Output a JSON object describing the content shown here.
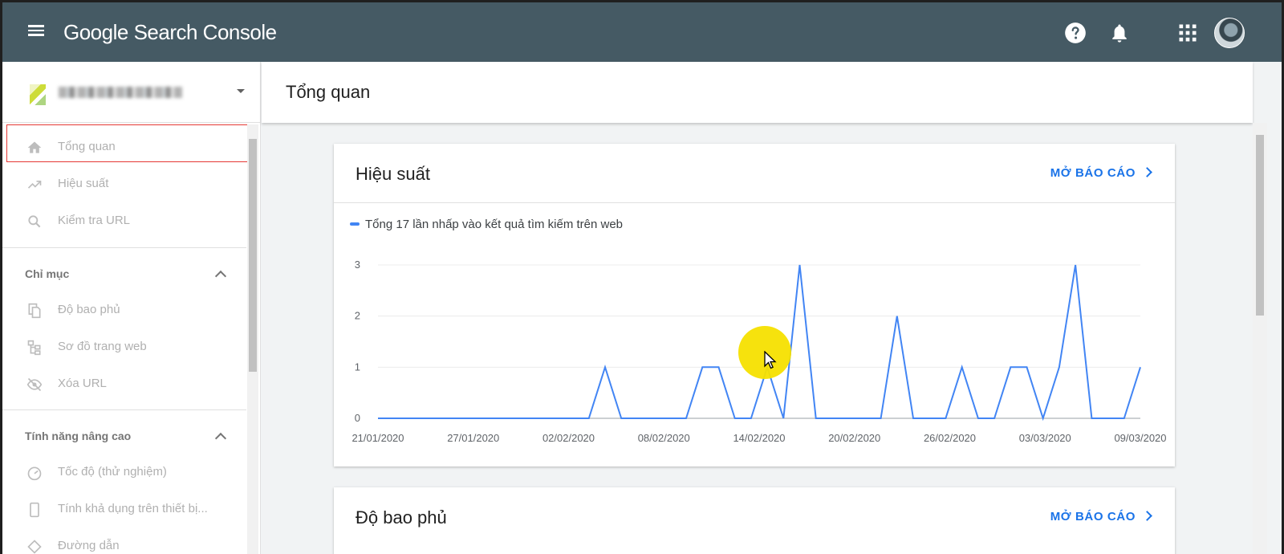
{
  "app": {
    "logo_text": "Google Search Console",
    "brand_color": "#455a64",
    "accent_color": "#1a73e8"
  },
  "topbar": {
    "icons": [
      "menu-icon",
      "help-icon",
      "notifications-icon",
      "apps-grid-icon",
      "avatar"
    ]
  },
  "sidebar": {
    "property": {
      "name": ""
    },
    "items": [
      {
        "label": "Tổng quan",
        "icon": "home-icon"
      },
      {
        "label": "Hiệu suất",
        "icon": "trending-up-icon"
      },
      {
        "label": "Kiểm tra URL",
        "icon": "search-icon"
      }
    ],
    "sections": [
      {
        "title": "Chỉ mục",
        "items": [
          {
            "label": "Độ bao phủ",
            "icon": "copy-pages-icon"
          },
          {
            "label": "Sơ đồ trang web",
            "icon": "sitemap-icon"
          },
          {
            "label": "Xóa URL",
            "icon": "eye-off-icon"
          }
        ]
      },
      {
        "title": "Tính năng nâng cao",
        "items": [
          {
            "label": "Tốc độ (thử nghiệm)",
            "icon": "speed-gauge-icon"
          },
          {
            "label": "Tính khả dụng trên thiết bị...",
            "icon": "smartphone-icon"
          },
          {
            "label": "Đường dẫn",
            "icon": "breadcrumb-icon"
          }
        ]
      }
    ]
  },
  "main": {
    "page_title": "Tổng quan",
    "cards": [
      {
        "title": "Hiệu suất",
        "link": "MỞ BÁO CÁO"
      },
      {
        "title": "Độ bao phủ",
        "link": "MỞ BÁO CÁO"
      }
    ]
  },
  "chart_data": {
    "type": "line",
    "legend": "Tổng 17 lần nhấp vào kết quả tìm kiếm trên web",
    "series": [
      {
        "color": "#4285f4",
        "values": [
          0,
          0,
          0,
          0,
          0,
          0,
          0,
          0,
          0,
          0,
          0,
          0,
          0,
          0,
          1,
          0,
          0,
          0,
          0,
          0,
          1,
          1,
          0,
          0,
          1,
          0,
          3,
          0,
          0,
          0,
          0,
          0,
          2,
          0,
          0,
          0,
          1,
          0,
          0,
          1,
          1,
          0,
          1,
          3,
          0,
          0,
          0,
          1
        ]
      }
    ],
    "x_tick_labels": [
      "21/01/2020",
      "27/01/2020",
      "02/02/2020",
      "08/02/2020",
      "14/02/2020",
      "20/02/2020",
      "26/02/2020",
      "03/03/2020",
      "09/03/2020"
    ],
    "y_ticks": [
      0,
      1,
      2,
      3
    ],
    "ylim": [
      0,
      3
    ],
    "grid": true
  }
}
